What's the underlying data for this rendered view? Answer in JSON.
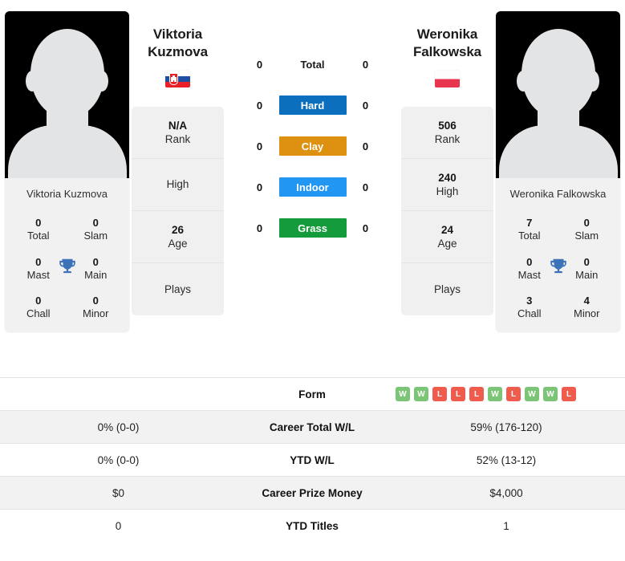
{
  "players": {
    "left": {
      "name_line1": "Viktoria",
      "name_line2": "Kuzmova",
      "full_name": "Viktoria Kuzmova",
      "photo_caption": "Viktoria Kuzmova",
      "flag": "slovakia-flag",
      "info": [
        {
          "value": "N/A",
          "label": "Rank"
        },
        {
          "value": "",
          "label": "High"
        },
        {
          "value": "26",
          "label": "Age"
        },
        {
          "value": "",
          "label": "Plays"
        }
      ],
      "titles": [
        {
          "value": "0",
          "label": "Total"
        },
        {
          "value": "0",
          "label": "Slam"
        },
        {
          "value": "0",
          "label": "Mast"
        },
        {
          "value": "0",
          "label": "Main"
        },
        {
          "value": "0",
          "label": "Chall"
        },
        {
          "value": "0",
          "label": "Minor"
        }
      ],
      "surfaces": {
        "total": "0",
        "hard": "0",
        "clay": "0",
        "indoor": "0",
        "grass": "0"
      }
    },
    "right": {
      "name_line1": "Weronika",
      "name_line2": "Falkowska",
      "full_name": "Weronika Falkowska",
      "photo_caption": "Weronika Falkowska",
      "flag": "poland-flag",
      "info": [
        {
          "value": "506",
          "label": "Rank"
        },
        {
          "value": "240",
          "label": "High"
        },
        {
          "value": "24",
          "label": "Age"
        },
        {
          "value": "",
          "label": "Plays"
        }
      ],
      "titles": [
        {
          "value": "7",
          "label": "Total"
        },
        {
          "value": "0",
          "label": "Slam"
        },
        {
          "value": "0",
          "label": "Mast"
        },
        {
          "value": "0",
          "label": "Main"
        },
        {
          "value": "3",
          "label": "Chall"
        },
        {
          "value": "4",
          "label": "Minor"
        }
      ],
      "surfaces": {
        "total": "0",
        "hard": "0",
        "clay": "0",
        "indoor": "0",
        "grass": "0"
      }
    }
  },
  "surface_rows": [
    {
      "key": "total",
      "label": "Total",
      "color": "none",
      "plain": true
    },
    {
      "key": "hard",
      "label": "Hard",
      "color": "#0b6fbe",
      "plain": false
    },
    {
      "key": "clay",
      "label": "Clay",
      "color": "#de9110",
      "plain": false
    },
    {
      "key": "indoor",
      "label": "Indoor",
      "color": "#2196f3",
      "plain": false
    },
    {
      "key": "grass",
      "label": "Grass",
      "color": "#149b3b",
      "plain": false
    }
  ],
  "table": {
    "form": {
      "label": "Form",
      "left_results": [],
      "right_results": [
        "W",
        "W",
        "L",
        "L",
        "L",
        "W",
        "L",
        "W",
        "W",
        "L"
      ]
    },
    "rows": [
      {
        "label": "Career Total W/L",
        "left": "0% (0-0)",
        "right": "59% (176-120)",
        "shaded": true
      },
      {
        "label": "YTD W/L",
        "left": "0% (0-0)",
        "right": "52% (13-12)",
        "shaded": false
      },
      {
        "label": "Career Prize Money",
        "left": "$0",
        "right": "$4,000",
        "shaded": true
      },
      {
        "label": "YTD Titles",
        "left": "0",
        "right": "1",
        "shaded": false
      }
    ]
  },
  "colors": {
    "hard": "#0b6fbe",
    "clay": "#de9110",
    "indoor": "#2196f3",
    "grass": "#149b3b",
    "win": "#7cc576",
    "loss": "#ef5b4c",
    "trophy": "#3b72b8",
    "card_bg": "#f0f0f0",
    "row_shaded": "#f2f2f2"
  }
}
